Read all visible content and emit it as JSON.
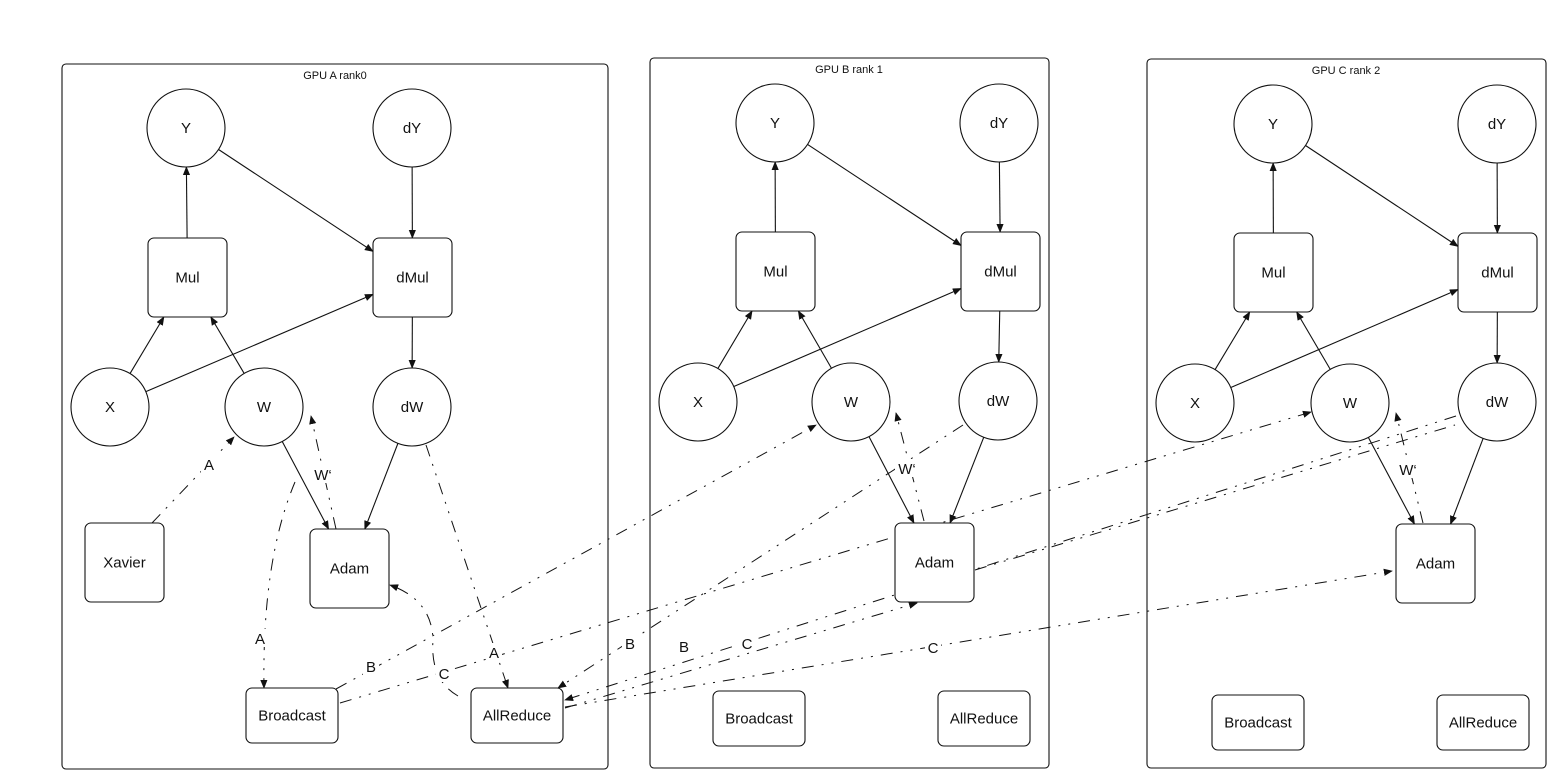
{
  "diagram": {
    "groups": [
      {
        "id": "A",
        "title": "GPU A rank0"
      },
      {
        "id": "B",
        "title": "GPU B rank 1"
      },
      {
        "id": "C",
        "title": "GPU C rank 2"
      }
    ],
    "node_labels": {
      "Y": "Y",
      "dY": "dY",
      "Mul": "Mul",
      "dMul": "dMul",
      "X": "X",
      "W": "W",
      "dW": "dW",
      "Adam": "Adam",
      "Xavier": "Xavier",
      "Broadcast": "Broadcast",
      "AllReduce": "AllReduce"
    },
    "nodes": [
      {
        "id": "A.Y",
        "group": "A",
        "label": "Y",
        "shape": "circle"
      },
      {
        "id": "A.dY",
        "group": "A",
        "label": "dY",
        "shape": "circle"
      },
      {
        "id": "A.Mul",
        "group": "A",
        "label": "Mul",
        "shape": "box"
      },
      {
        "id": "A.dMul",
        "group": "A",
        "label": "dMul",
        "shape": "box"
      },
      {
        "id": "A.X",
        "group": "A",
        "label": "X",
        "shape": "circle"
      },
      {
        "id": "A.W",
        "group": "A",
        "label": "W",
        "shape": "circle"
      },
      {
        "id": "A.dW",
        "group": "A",
        "label": "dW",
        "shape": "circle"
      },
      {
        "id": "A.Xavier",
        "group": "A",
        "label": "Xavier",
        "shape": "box"
      },
      {
        "id": "A.Adam",
        "group": "A",
        "label": "Adam",
        "shape": "box"
      },
      {
        "id": "A.Broadcast",
        "group": "A",
        "label": "Broadcast",
        "shape": "box"
      },
      {
        "id": "A.AllReduce",
        "group": "A",
        "label": "AllReduce",
        "shape": "box"
      },
      {
        "id": "B.Y",
        "group": "B",
        "label": "Y",
        "shape": "circle"
      },
      {
        "id": "B.dY",
        "group": "B",
        "label": "dY",
        "shape": "circle"
      },
      {
        "id": "B.Mul",
        "group": "B",
        "label": "Mul",
        "shape": "box"
      },
      {
        "id": "B.dMul",
        "group": "B",
        "label": "dMul",
        "shape": "box"
      },
      {
        "id": "B.X",
        "group": "B",
        "label": "X",
        "shape": "circle"
      },
      {
        "id": "B.W",
        "group": "B",
        "label": "W",
        "shape": "circle"
      },
      {
        "id": "B.dW",
        "group": "B",
        "label": "dW",
        "shape": "circle"
      },
      {
        "id": "B.Adam",
        "group": "B",
        "label": "Adam",
        "shape": "box"
      },
      {
        "id": "B.Broadcast",
        "group": "B",
        "label": "Broadcast",
        "shape": "box"
      },
      {
        "id": "B.AllReduce",
        "group": "B",
        "label": "AllReduce",
        "shape": "box"
      },
      {
        "id": "C.Y",
        "group": "C",
        "label": "Y",
        "shape": "circle"
      },
      {
        "id": "C.dY",
        "group": "C",
        "label": "dY",
        "shape": "circle"
      },
      {
        "id": "C.Mul",
        "group": "C",
        "label": "Mul",
        "shape": "box"
      },
      {
        "id": "C.dMul",
        "group": "C",
        "label": "dMul",
        "shape": "box"
      },
      {
        "id": "C.X",
        "group": "C",
        "label": "X",
        "shape": "circle"
      },
      {
        "id": "C.W",
        "group": "C",
        "label": "W",
        "shape": "circle"
      },
      {
        "id": "C.dW",
        "group": "C",
        "label": "dW",
        "shape": "circle"
      },
      {
        "id": "C.Adam",
        "group": "C",
        "label": "Adam",
        "shape": "box"
      },
      {
        "id": "C.Broadcast",
        "group": "C",
        "label": "Broadcast",
        "shape": "box"
      },
      {
        "id": "C.AllReduce",
        "group": "C",
        "label": "AllReduce",
        "shape": "box"
      }
    ],
    "edges": [
      {
        "from": "Mul",
        "to": "Y",
        "style": "solid",
        "label": ""
      },
      {
        "from": "Y",
        "to": "dMul",
        "style": "solid",
        "label": ""
      },
      {
        "from": "dY",
        "to": "dMul",
        "style": "solid",
        "label": ""
      },
      {
        "from": "X",
        "to": "Mul",
        "style": "solid",
        "label": ""
      },
      {
        "from": "W",
        "to": "Mul",
        "style": "solid",
        "label": ""
      },
      {
        "from": "X",
        "to": "dMul",
        "style": "solid",
        "label": ""
      },
      {
        "from": "dMul",
        "to": "dW",
        "style": "solid",
        "label": ""
      },
      {
        "from": "W",
        "to": "Adam",
        "style": "solid",
        "label": ""
      },
      {
        "from": "dW",
        "to": "Adam",
        "style": "solid",
        "label": ""
      },
      {
        "from": "Adam",
        "to": "W",
        "style": "dashdot",
        "label": "W‘"
      }
    ],
    "cross_edges": [
      {
        "from": "A.Xavier",
        "to": "A.W",
        "label": "A"
      },
      {
        "from": "A.W",
        "to": "A.Broadcast",
        "label": "A"
      },
      {
        "from": "A.dW",
        "to": "A.AllReduce",
        "label": "A"
      },
      {
        "from": "A.AllReduce",
        "to": "A.Adam",
        "label": "C"
      },
      {
        "from": "A.Broadcast",
        "to": "B.W",
        "label": "B"
      },
      {
        "from": "A.Broadcast",
        "to": "C.W",
        "label": "C"
      },
      {
        "from": "B.dW",
        "to": "A.AllReduce",
        "label": "B"
      },
      {
        "from": "C.dW",
        "to": "A.AllReduce",
        "label": "C"
      },
      {
        "from": "A.AllReduce",
        "to": "B.Adam",
        "label": "B"
      },
      {
        "from": "A.AllReduce",
        "to": "C.Adam",
        "label": "C"
      }
    ],
    "edge_labels": {
      "A": "A",
      "B": "B",
      "C": "C",
      "Wprime": "W‘"
    }
  }
}
